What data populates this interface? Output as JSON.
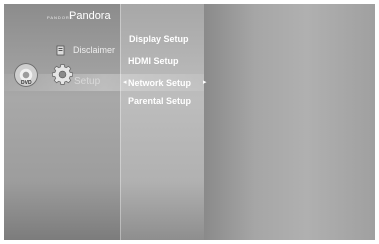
{
  "brand": {
    "small_text": "PANDORA",
    "name": "Pandora"
  },
  "left_menu": {
    "items": [
      {
        "label": "Disclaimer",
        "icon": "disclaimer-icon"
      },
      {
        "label": "Setup",
        "icon": "gear-icon",
        "selected": true
      }
    ]
  },
  "disc": {
    "label": "DVD"
  },
  "sub_menu": {
    "items": [
      {
        "label": "Display Setup"
      },
      {
        "label": "HDMI Setup"
      },
      {
        "label": "Network Setup",
        "highlighted": true
      },
      {
        "label": "Parental Setup"
      }
    ],
    "arrow_left": "◂",
    "arrow_right": "▸"
  },
  "colors": {
    "text": "#ffffff",
    "highlight": "#cfcfcf"
  }
}
